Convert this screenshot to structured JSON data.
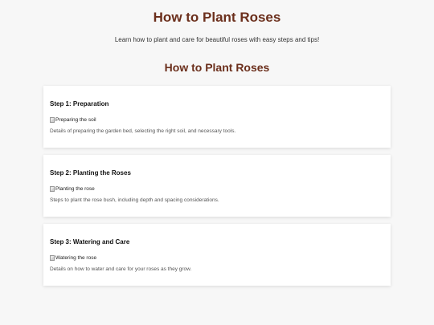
{
  "header": {
    "title": "How to Plant Roses",
    "subtitle": "Learn how to plant and care for beautiful roses with easy steps and tips!"
  },
  "section": {
    "title": "How to Plant Roses"
  },
  "steps": [
    {
      "title": "Step 1: Preparation",
      "image_alt": "Preparing the soil",
      "description": "Details of preparing the garden bed, selecting the right soil, and necessary tools."
    },
    {
      "title": "Step 2: Planting the Roses",
      "image_alt": "Planting the rose",
      "description": "Steps to plant the rose bush, including depth and spacing considerations."
    },
    {
      "title": "Step 3: Watering and Care",
      "image_alt": "Watering the rose",
      "description": "Details on how to water and care for your roses as they grow."
    }
  ],
  "colors": {
    "heading": "#6b2f1c",
    "background": "#f7f7f7",
    "card": "#ffffff"
  },
  "icons": {
    "step_image": "broken-image-icon"
  }
}
